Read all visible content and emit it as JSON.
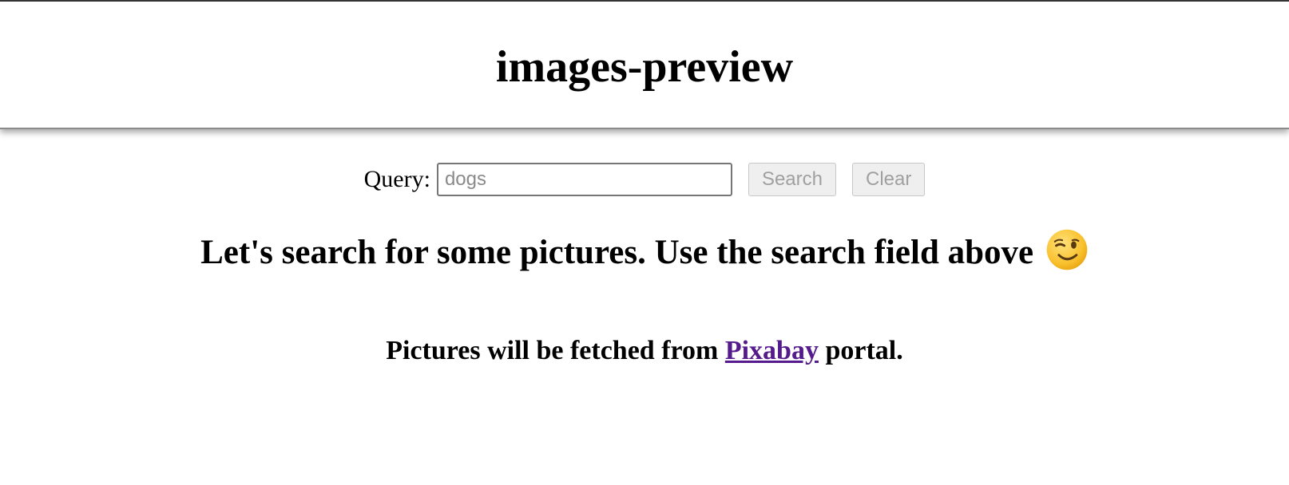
{
  "header": {
    "title": "images-preview"
  },
  "search": {
    "label": "Query:",
    "placeholder": "dogs",
    "value": "",
    "search_button": "Search",
    "clear_button": "Clear"
  },
  "main": {
    "intro_text": "Let's search for some pictures. Use the search field above",
    "intro_emoji": "winking-face-icon",
    "note_prefix": "Pictures will be fetched from",
    "note_link": "Pixabay",
    "note_suffix": "portal."
  },
  "colors": {
    "link_visited": "#551a8b",
    "button_disabled_text": "#a0a0a0",
    "button_disabled_bg": "#efefef"
  }
}
